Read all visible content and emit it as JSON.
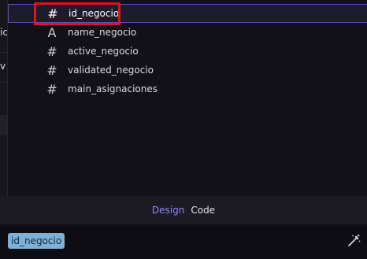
{
  "left_panel": {
    "row1_fragment": "ic",
    "row2_fragment": "v"
  },
  "field_dropdown": {
    "options": [
      {
        "icon": "hash-icon",
        "glyph": "#",
        "label": "id_negocio",
        "selected": true
      },
      {
        "icon": "text-type-icon",
        "glyph": "A",
        "label": "name_negocio",
        "selected": false
      },
      {
        "icon": "hash-icon",
        "glyph": "#",
        "label": "active_negocio",
        "selected": false
      },
      {
        "icon": "hash-icon",
        "glyph": "#",
        "label": "validated_negocio",
        "selected": false
      },
      {
        "icon": "hash-icon",
        "glyph": "#",
        "label": "main_asignaciones",
        "selected": false
      }
    ]
  },
  "mode_toggle": {
    "design_label": "Design",
    "code_label": "Code",
    "active": "Design"
  },
  "input": {
    "token_label": "id_negocio",
    "action_icon": "magic-wand-icon"
  },
  "colors": {
    "accent": "#8f86ff",
    "selection_border": "#5a4fc0",
    "token_bg": "#7fb0d6",
    "annotation_red": "#e3121a"
  }
}
